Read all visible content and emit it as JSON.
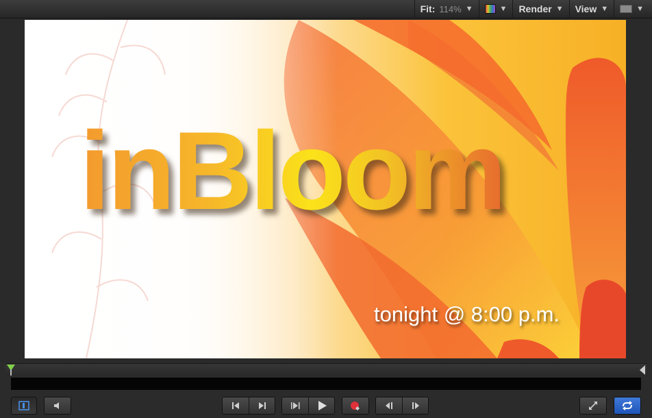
{
  "toolbar": {
    "fit_label": "Fit:",
    "fit_value": "114%",
    "render_label": "Render",
    "view_label": "View",
    "icons": [
      "color-channel-icon",
      "layout-icon",
      "dropdown-caret-icon"
    ]
  },
  "canvas": {
    "title": "inBloom",
    "subtitle": "tonight @ 8:00 p.m.",
    "colors": {
      "title_gradient": [
        "#f39a2e",
        "#fbe21a",
        "#e76b2e"
      ],
      "petal": "#f06a2a",
      "petal_light": "#f9b032"
    }
  },
  "transport": {
    "icons": [
      "canvas-panel-icon",
      "speaker-icon",
      "go-to-start-icon",
      "go-to-end-icon",
      "play-from-start-icon",
      "play-icon",
      "record-icon",
      "previous-frame-icon",
      "next-frame-icon",
      "fullscreen-icon",
      "loop-icon"
    ]
  }
}
